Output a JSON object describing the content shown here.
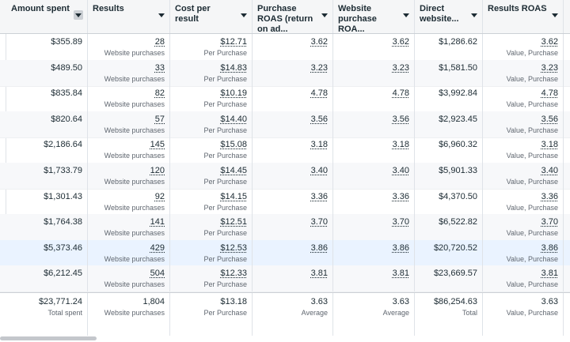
{
  "columns": [
    {
      "label": "Amount spent",
      "sort": "boxed"
    },
    {
      "label": "Results"
    },
    {
      "label": "Cost per result"
    },
    {
      "label": "Purchase ROAS (return on ad..."
    },
    {
      "label": "Website purchase ROA..."
    },
    {
      "label": "Direct website..."
    },
    {
      "label": "Results ROAS"
    }
  ],
  "rows": [
    {
      "amount": "$355.89",
      "results": "28",
      "results_sub": "Website purchases",
      "cpr": "$12.71",
      "cpr_sub": "Per Purchase",
      "proas": "3.62",
      "wproas": "3.62",
      "direct": "$1,286.62",
      "rroas": "3.62",
      "rroas_sub": "Value, Purchase"
    },
    {
      "amount": "$489.50",
      "results": "33",
      "results_sub": "Website purchases",
      "cpr": "$14.83",
      "cpr_sub": "Per Purchase",
      "proas": "3.23",
      "wproas": "3.23",
      "direct": "$1,581.50",
      "rroas": "3.23",
      "rroas_sub": "Value, Purchase"
    },
    {
      "amount": "$835.84",
      "results": "82",
      "results_sub": "Website purchases",
      "cpr": "$10.19",
      "cpr_sub": "Per Purchase",
      "proas": "4.78",
      "wproas": "4.78",
      "direct": "$3,992.84",
      "rroas": "4.78",
      "rroas_sub": "Value, Purchase"
    },
    {
      "amount": "$820.64",
      "results": "57",
      "results_sub": "Website purchases",
      "cpr": "$14.40",
      "cpr_sub": "Per Purchase",
      "proas": "3.56",
      "wproas": "3.56",
      "direct": "$2,923.45",
      "rroas": "3.56",
      "rroas_sub": "Value, Purchase"
    },
    {
      "amount": "$2,186.64",
      "results": "145",
      "results_sub": "Website purchases",
      "cpr": "$15.08",
      "cpr_sub": "Per Purchase",
      "proas": "3.18",
      "wproas": "3.18",
      "direct": "$6,960.32",
      "rroas": "3.18",
      "rroas_sub": "Value, Purchase"
    },
    {
      "amount": "$1,733.79",
      "results": "120",
      "results_sub": "Website purchases",
      "cpr": "$14.45",
      "cpr_sub": "Per Purchase",
      "proas": "3.40",
      "wproas": "3.40",
      "direct": "$5,901.33",
      "rroas": "3.40",
      "rroas_sub": "Value, Purchase"
    },
    {
      "amount": "$1,301.43",
      "results": "92",
      "results_sub": "Website purchases",
      "cpr": "$14.15",
      "cpr_sub": "Per Purchase",
      "proas": "3.36",
      "wproas": "3.36",
      "direct": "$4,370.50",
      "rroas": "3.36",
      "rroas_sub": "Value, Purchase"
    },
    {
      "amount": "$1,764.38",
      "results": "141",
      "results_sub": "Website purchases",
      "cpr": "$12.51",
      "cpr_sub": "Per Purchase",
      "proas": "3.70",
      "wproas": "3.70",
      "direct": "$6,522.82",
      "rroas": "3.70",
      "rroas_sub": "Value, Purchase"
    },
    {
      "amount": "$5,373.46",
      "results": "429",
      "results_sub": "Website purchases",
      "cpr": "$12.53",
      "cpr_sub": "Per Purchase",
      "proas": "3.86",
      "wproas": "3.86",
      "direct": "$20,720.52",
      "rroas": "3.86",
      "rroas_sub": "Value, Purchase",
      "highlight": true
    },
    {
      "amount": "$6,212.45",
      "results": "504",
      "results_sub": "Website purchases",
      "cpr": "$12.33",
      "cpr_sub": "Per Purchase",
      "proas": "3.81",
      "wproas": "3.81",
      "direct": "$23,669.57",
      "rroas": "3.81",
      "rroas_sub": "Value, Purchase"
    }
  ],
  "totals": {
    "amount": "$23,771.24",
    "amount_sub": "Total spent",
    "results": "1,804",
    "results_sub": "Website purchases",
    "cpr": "$13.18",
    "cpr_sub": "Per Purchase",
    "proas": "3.63",
    "proas_sub": "Average",
    "wproas": "3.63",
    "wproas_sub": "Average",
    "direct": "$86,254.63",
    "direct_sub": "Total",
    "rroas": "3.63",
    "rroas_sub": "Value, Purchase"
  },
  "colors": {
    "header_bg": "#f5f6f7",
    "row_alt": "#f7f8fa",
    "row_highlight": "#eaf3ff",
    "text": "#1c2b33",
    "sub_text": "#606770"
  }
}
